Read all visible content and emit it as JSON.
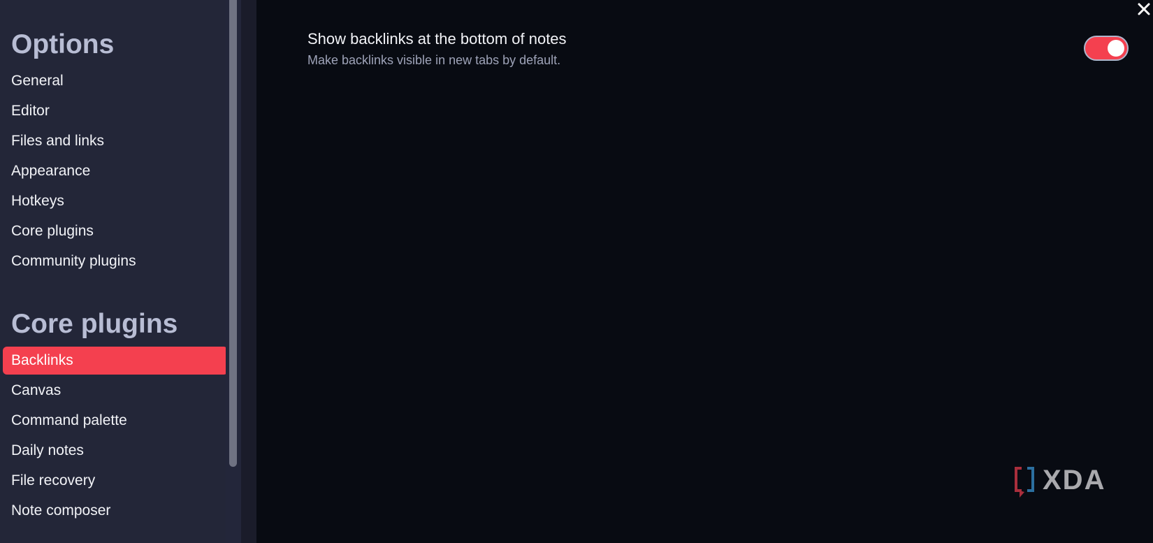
{
  "sidebar": {
    "options_title": "Options",
    "options_items": [
      {
        "label": "General"
      },
      {
        "label": "Editor"
      },
      {
        "label": "Files and links"
      },
      {
        "label": "Appearance"
      },
      {
        "label": "Hotkeys"
      },
      {
        "label": "Core plugins"
      },
      {
        "label": "Community plugins"
      }
    ],
    "core_plugins_title": "Core plugins",
    "core_plugins_items": [
      {
        "label": "Backlinks",
        "active": true
      },
      {
        "label": "Canvas"
      },
      {
        "label": "Command palette"
      },
      {
        "label": "Daily notes"
      },
      {
        "label": "File recovery"
      },
      {
        "label": "Note composer"
      }
    ]
  },
  "setting": {
    "name": "Show backlinks at the bottom of notes",
    "description": "Make backlinks visible in new tabs by default.",
    "enabled": true
  },
  "watermark": {
    "text": "XDA"
  },
  "icons": {
    "close": "close-icon"
  },
  "colors": {
    "accent": "#f4404f",
    "sidebar_bg": "#232638",
    "main_bg": "#080b12",
    "heading": "#b8bdd4",
    "text": "#f2f3f7",
    "muted": "#9ea3b8"
  }
}
